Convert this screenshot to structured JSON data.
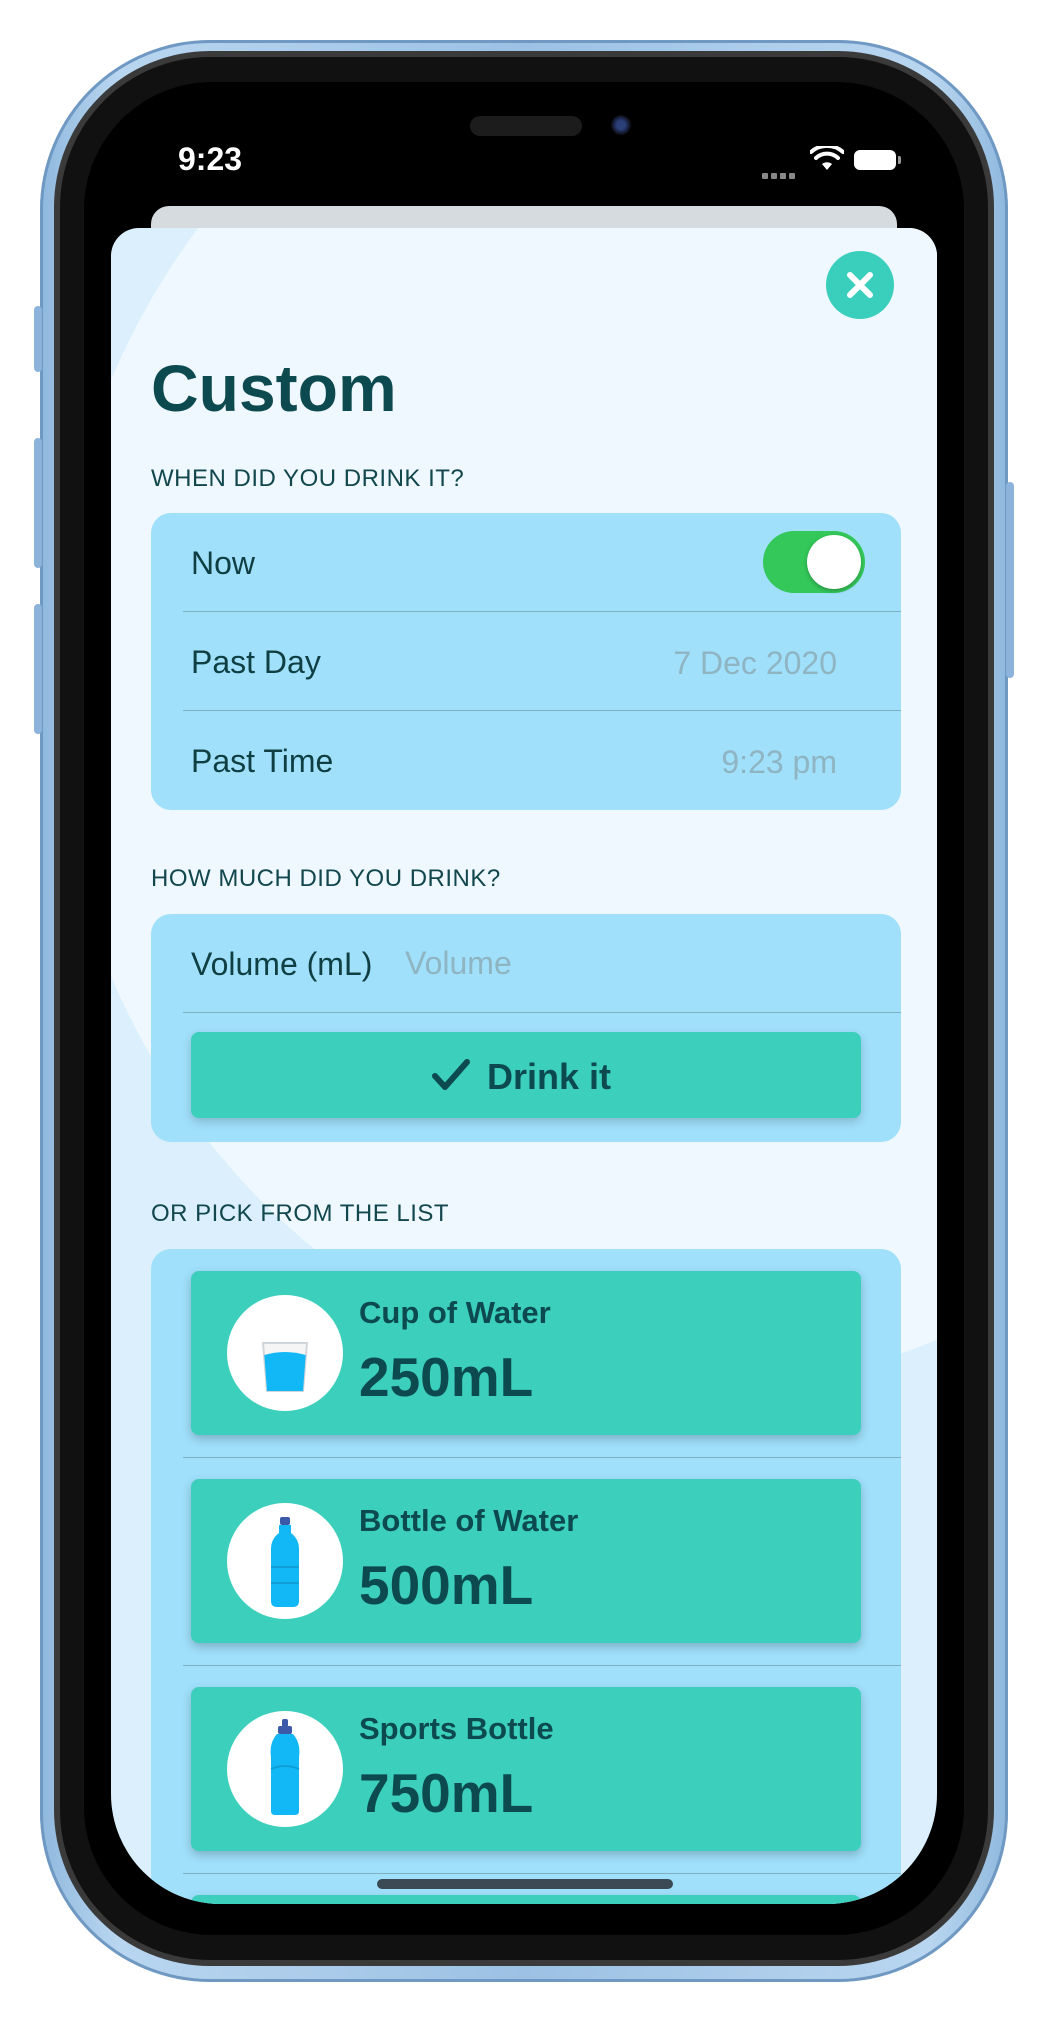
{
  "status_bar": {
    "time": "9:23"
  },
  "page": {
    "title": "Custom"
  },
  "when_section": {
    "label": "WHEN DID YOU DRINK IT?",
    "now_label": "Now",
    "now_enabled": true,
    "past_day_label": "Past Day",
    "past_day_value": "7 Dec 2020",
    "past_time_label": "Past Time",
    "past_time_value": "9:23 pm"
  },
  "how_much_section": {
    "label": "HOW MUCH DID YOU DRINK?",
    "volume_label": "Volume (mL)",
    "volume_placeholder": "Volume",
    "volume_value": "",
    "drink_button_label": "Drink it"
  },
  "list_section": {
    "label": "OR PICK FROM THE LIST",
    "items": [
      {
        "name": "Cup of Water",
        "amount": "250mL",
        "icon": "cup-icon"
      },
      {
        "name": "Bottle of Water",
        "amount": "500mL",
        "icon": "bottle-icon"
      },
      {
        "name": "Sports Bottle",
        "amount": "750mL",
        "icon": "sports-bottle-icon"
      }
    ]
  },
  "colors": {
    "accent": "#3bcfbc",
    "group_background": "#a0e0fb",
    "title_text": "#0c4a4f",
    "toggle_on": "#34c759",
    "water": "#12b8f5"
  }
}
